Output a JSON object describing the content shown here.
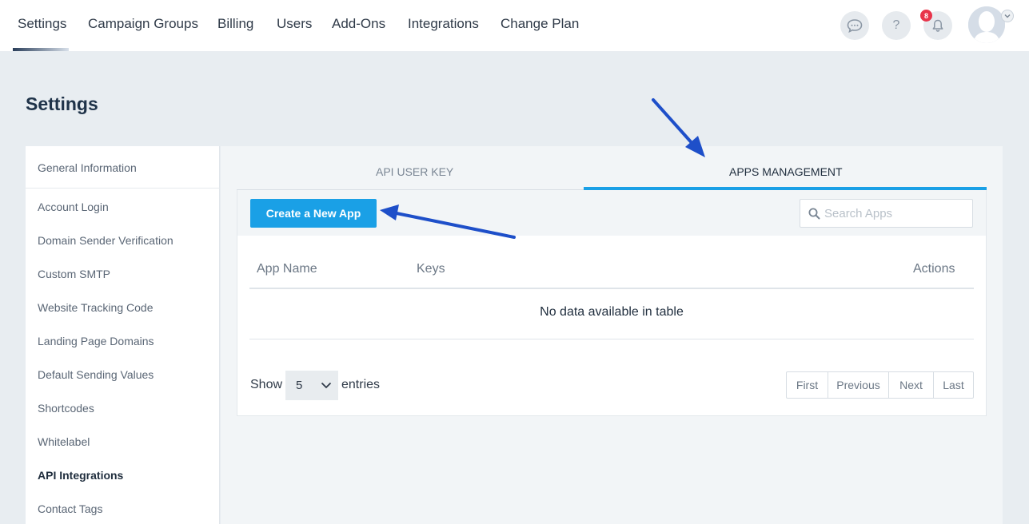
{
  "topnav": {
    "items": [
      "Settings",
      "Campaign Groups",
      "Billing",
      "Users",
      "Add-Ons",
      "Integrations",
      "Change Plan"
    ],
    "help_label": "?",
    "notification_count": "8"
  },
  "page": {
    "title": "Settings"
  },
  "sidebar": {
    "items": [
      {
        "label": "General Information"
      },
      {
        "label": "Account Login"
      },
      {
        "label": "Domain Sender Verification"
      },
      {
        "label": "Custom SMTP"
      },
      {
        "label": "Website Tracking Code"
      },
      {
        "label": "Landing Page Domains"
      },
      {
        "label": "Default Sending Values"
      },
      {
        "label": "Shortcodes"
      },
      {
        "label": "Whitelabel"
      },
      {
        "label": "API Integrations",
        "active": true
      },
      {
        "label": "Contact Tags"
      }
    ]
  },
  "tabs": {
    "api_user_key": "API USER KEY",
    "apps_management": "APPS MANAGEMENT",
    "selected": "apps_management"
  },
  "toolbar": {
    "create_button": "Create a New App",
    "search_placeholder": "Search Apps"
  },
  "table": {
    "columns": [
      "App Name",
      "Keys",
      "Actions"
    ],
    "empty_message": "No data available in table"
  },
  "pagination": {
    "show_label": "Show",
    "entries_label": "entries",
    "page_size": "5",
    "buttons": [
      "First",
      "Previous",
      "Next",
      "Last"
    ]
  },
  "colors": {
    "accent": "#1aa0e6",
    "badge": "#e8344a",
    "annotation_arrow": "#1e4fc9"
  }
}
